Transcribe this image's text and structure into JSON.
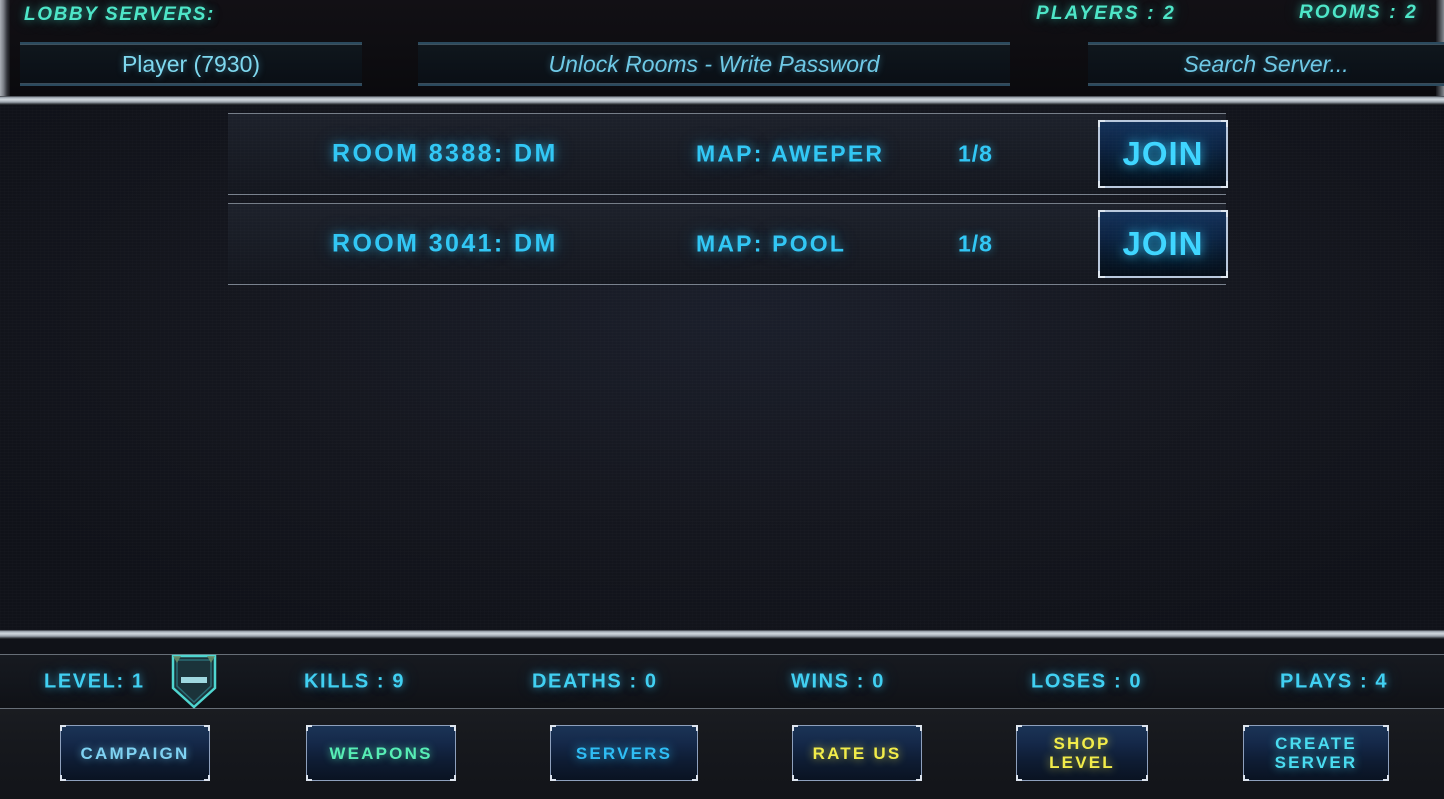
{
  "header": {
    "lobby_title": "LOBBY SERVERS:",
    "players_count": "PLAYERS : 2",
    "rooms_count": "ROOMS : 2",
    "player_name_value": "Player (7930)",
    "password_placeholder": "Unlock Rooms - Write Password",
    "search_placeholder": "Search  Server..."
  },
  "rooms": [
    {
      "name": "ROOM 8388: DM",
      "map": "MAP: AWEPER",
      "slots": "1/8",
      "join_label": "JOIN"
    },
    {
      "name": "ROOM 3041: DM",
      "map": "MAP: POOL",
      "slots": "1/8",
      "join_label": "JOIN"
    }
  ],
  "stats": {
    "level": "LEVEL: 1",
    "kills": "KILLS : 9",
    "deaths": "DEATHS : 0",
    "wins": "WINS : 0",
    "loses": "LOSES : 0",
    "plays": "PLAYS : 4",
    "rank_badge_icon": "shield-rank-icon"
  },
  "nav": [
    {
      "label": "CAMPAIGN",
      "color_class": "nav-blue"
    },
    {
      "label": "WEAPONS",
      "color_class": "nav-green"
    },
    {
      "label": "SERVERS",
      "color_class": "nav-bright"
    },
    {
      "label": "RATE US",
      "color_class": "nav-yellow"
    },
    {
      "label": "SHOP\nLEVEL",
      "color_class": "nav-yellow"
    },
    {
      "label": "CREATE\nSERVER",
      "color_class": "nav-cyan"
    }
  ],
  "colors": {
    "accent_cyan": "#31c7f5",
    "accent_teal": "#4ee6c8",
    "accent_yellow": "#f2ec4a",
    "accent_green": "#57edb5",
    "panel_dark": "#15171f",
    "divider_silver": "#cfd6dd"
  }
}
